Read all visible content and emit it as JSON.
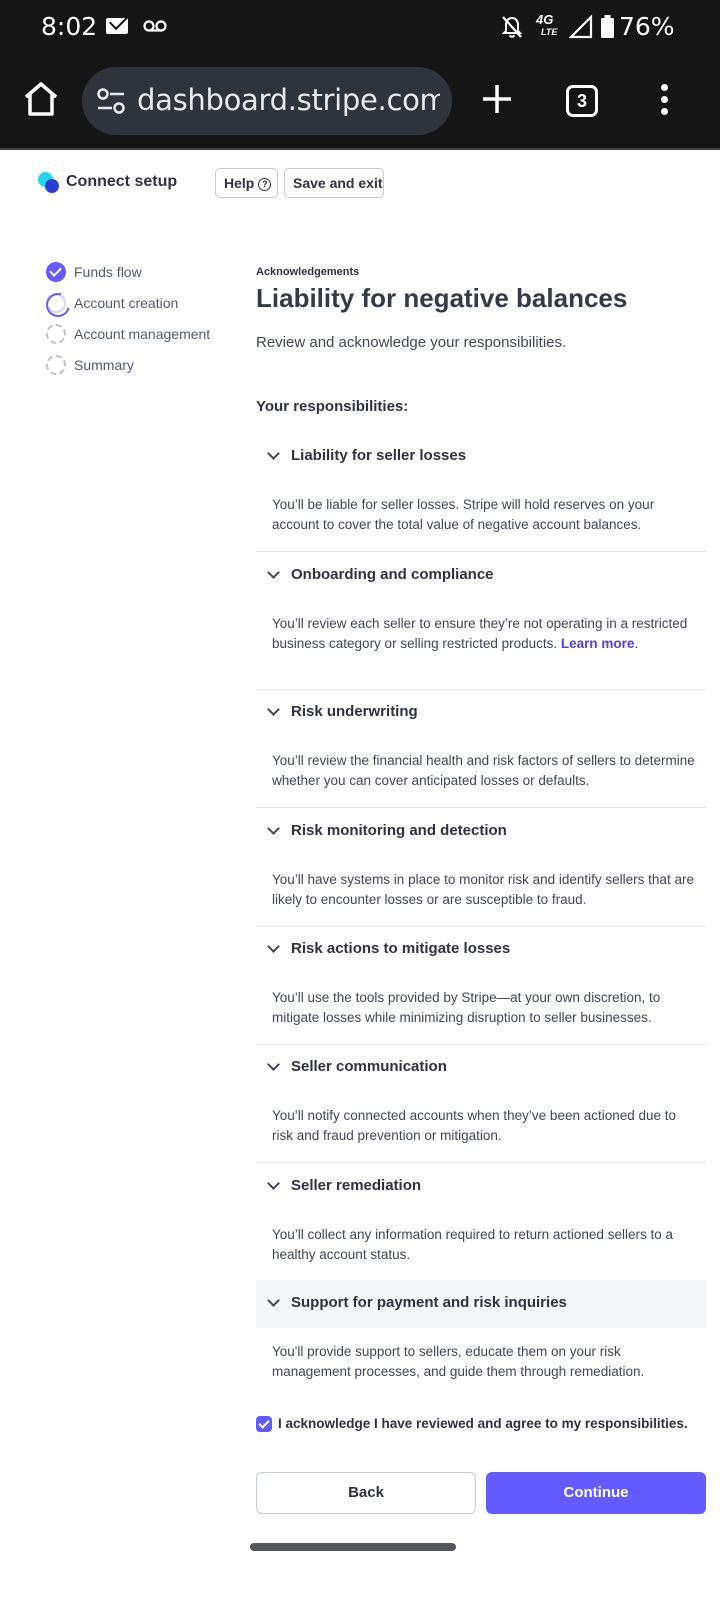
{
  "status_bar": {
    "time": "8:02",
    "network": "4G",
    "network_sub": "LTE",
    "battery": "76%"
  },
  "browser": {
    "url": "dashboard.stripe.com/co",
    "tab_count": "3"
  },
  "header": {
    "title": "Connect setup",
    "help_label": "Help",
    "help_icon_glyph": "?",
    "save_exit_label": "Save and exit"
  },
  "steps": [
    {
      "label": "Funds flow",
      "state": "complete"
    },
    {
      "label": "Account creation",
      "state": "in-progress"
    },
    {
      "label": "Account management",
      "state": "todo"
    },
    {
      "label": "Summary",
      "state": "todo"
    }
  ],
  "main": {
    "eyebrow": "Acknowledgements",
    "title": "Liability for negative balances",
    "subtitle": "Review and acknowledge your responsibilities.",
    "responsibilities_heading": "Your responsibilities:",
    "items": [
      {
        "title": "Liability for seller losses",
        "body": "You’ll be liable for seller losses. Stripe will hold reserves on your account to cover the total value of negative account balances."
      },
      {
        "title": "Onboarding and compliance",
        "body": "You’ll review each seller to ensure they’re not operating in a restricted business category or selling restricted products.",
        "link": "Learn more",
        "link_suffix": "."
      },
      {
        "title": "Risk underwriting",
        "body": "You’ll review the financial health and risk factors of sellers to determine whether you can cover anticipated losses or defaults."
      },
      {
        "title": "Risk monitoring and detection",
        "body": "You’ll have systems in place to monitor risk and identify sellers that are likely to encounter losses or are susceptible to fraud."
      },
      {
        "title": "Risk actions to mitigate losses",
        "body": "You’ll use the tools provided by Stripe—at your own discretion, to mitigate losses while minimizing disruption to seller businesses."
      },
      {
        "title": "Seller communication",
        "body": "You’ll notify connected accounts when they’ve been actioned due to risk and fraud prevention or mitigation."
      },
      {
        "title": "Seller remediation",
        "body": "You’ll collect any information required to return actioned sellers to a healthy account status."
      },
      {
        "title": "Support for payment and risk inquiries",
        "body": "You'll provide support to sellers, educate them on your risk management processes, and guide them through remediation."
      }
    ],
    "acknowledge_label": "I acknowledge I have reviewed and agree to my responsibilities.",
    "acknowledge_checked": true,
    "back_label": "Back",
    "continue_label": "Continue"
  },
  "colors": {
    "accent": "#635bff",
    "link": "#533afd",
    "dark_bar": "#151515"
  },
  "icons": [
    "mail-icon",
    "voicemail-icon",
    "bell-off-icon",
    "signal-icon",
    "battery-icon",
    "home-icon",
    "site-settings-icon",
    "plus-icon",
    "tabs-icon",
    "more-vert-icon",
    "stripe-connect-logo-icon",
    "help-circle-icon",
    "check-circle-icon",
    "chevron-down-icon",
    "checkbox-icon"
  ]
}
